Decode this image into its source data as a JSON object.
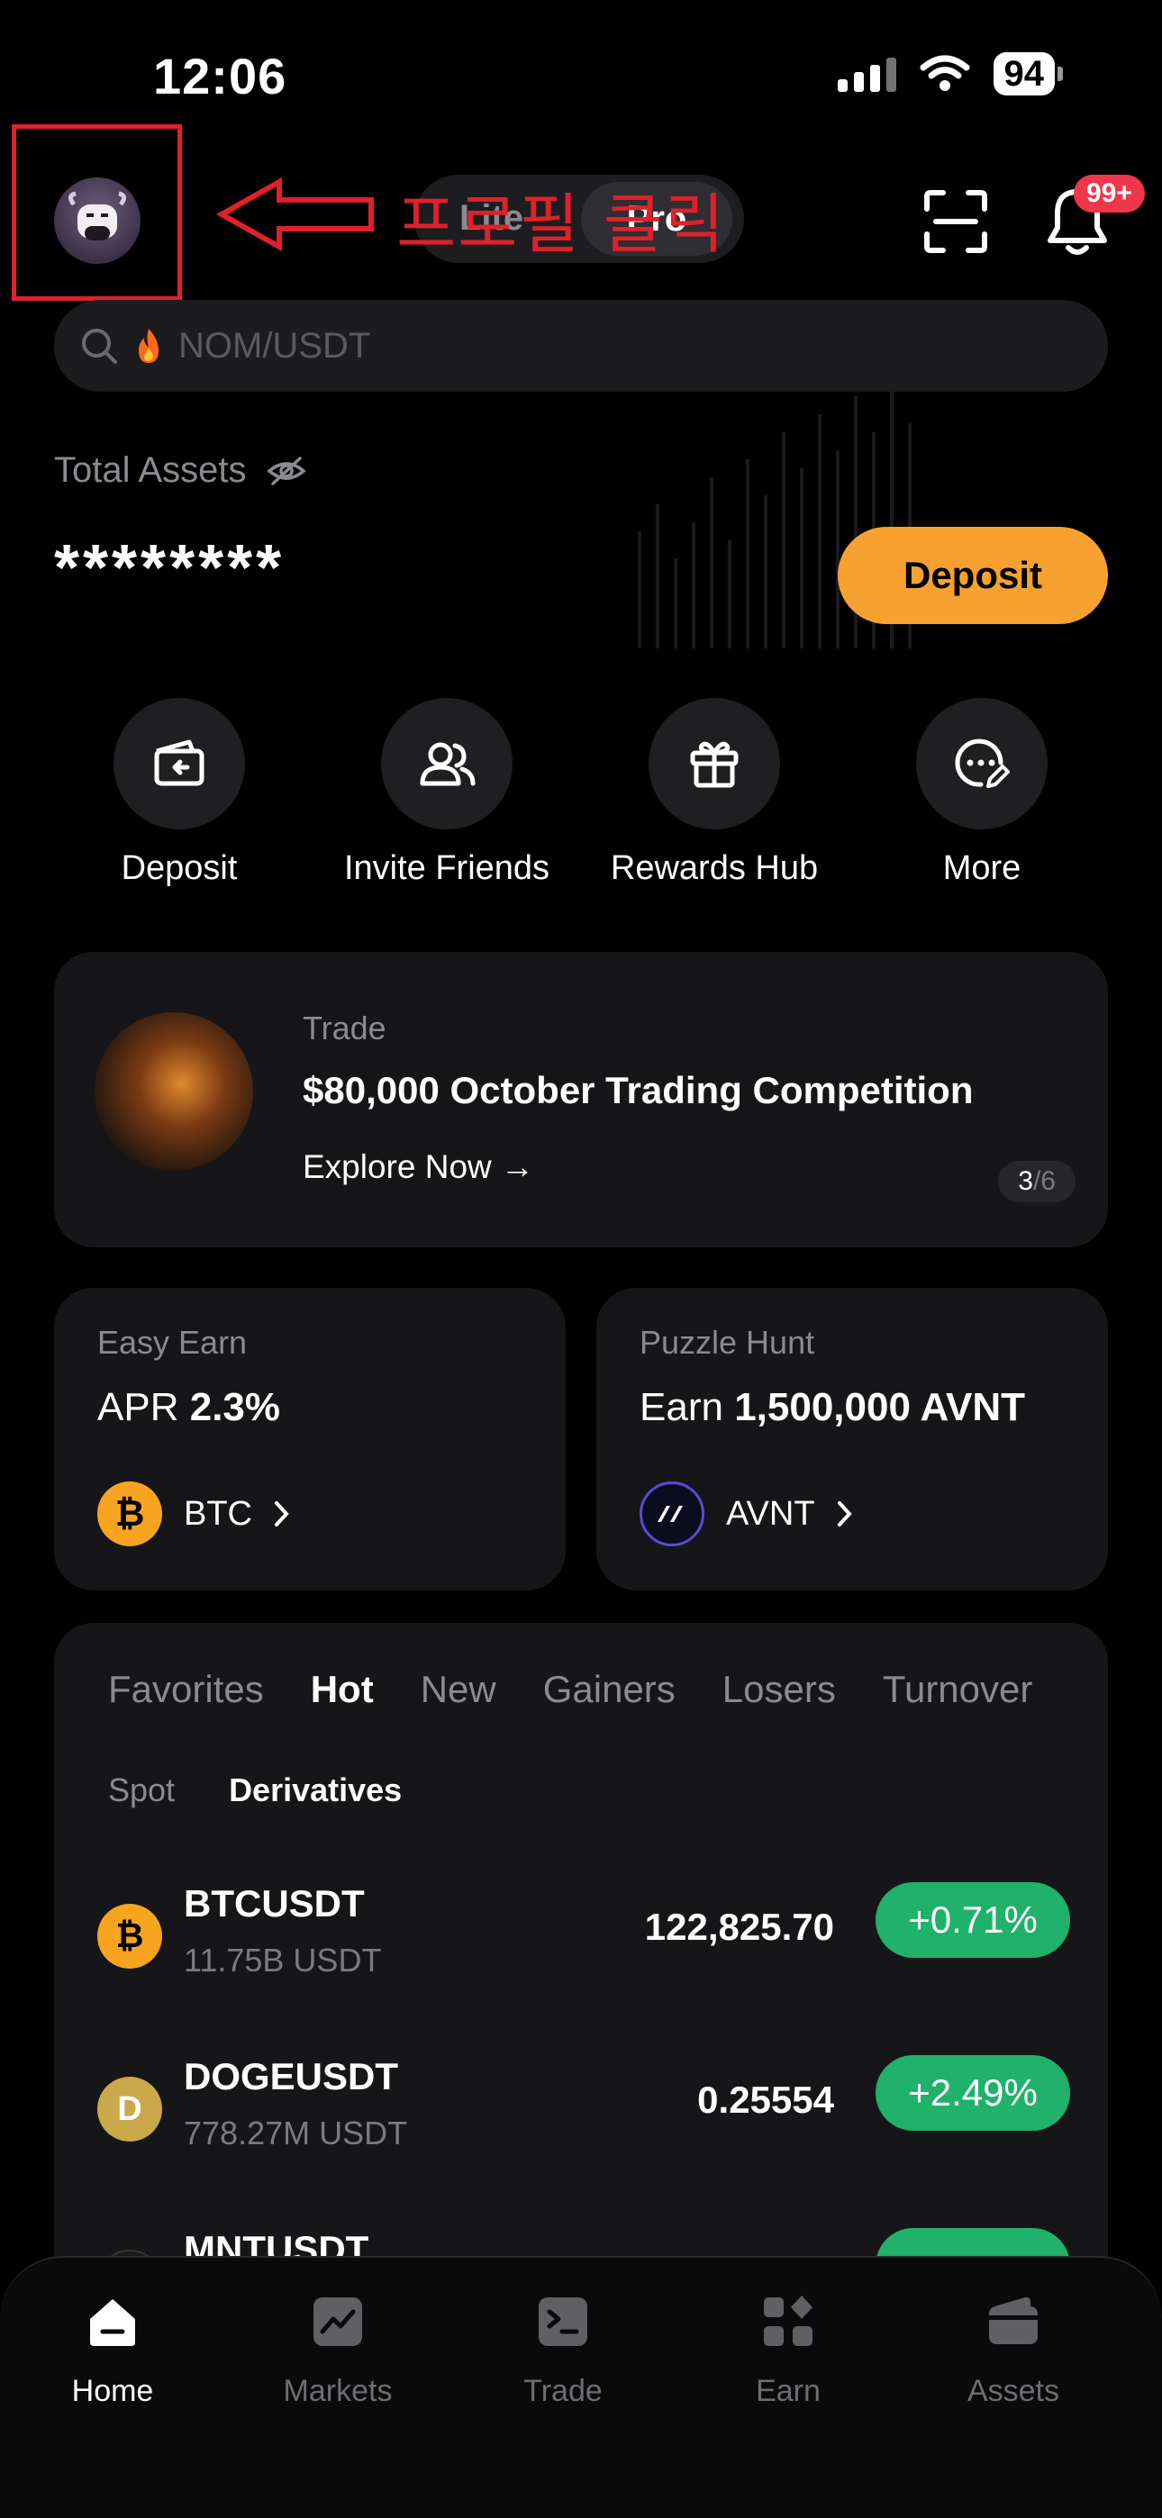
{
  "status_bar": {
    "time": "12:06",
    "battery": "94"
  },
  "header": {
    "mode_lite": "Lite",
    "mode_pro": "Pro",
    "annotation": "프로필 클릭",
    "notification_count": "99+"
  },
  "search": {
    "placeholder": "NOM/USDT"
  },
  "assets": {
    "label": "Total Assets",
    "value": "********",
    "deposit_button": "Deposit"
  },
  "quick_actions": [
    {
      "label": "Deposit",
      "icon": "wallet-icon"
    },
    {
      "label": "Invite Friends",
      "icon": "users-icon"
    },
    {
      "label": "Rewards Hub",
      "icon": "gift-icon"
    },
    {
      "label": "More",
      "icon": "more-icon"
    }
  ],
  "promo": {
    "category": "Trade",
    "title": "$80,000 October Trading Competition",
    "link": "Explore Now →",
    "page_current": "3",
    "page_total": "/6"
  },
  "earn_cards": [
    {
      "title": "Easy Earn",
      "prefix": "APR",
      "value": "2.3%",
      "coin": "BTC"
    },
    {
      "title": "Puzzle Hunt",
      "prefix": "Earn",
      "value": "1,500,000 AVNT",
      "coin": "AVNT"
    }
  ],
  "market": {
    "tabs": [
      "Favorites",
      "Hot",
      "New",
      "Gainers",
      "Losers",
      "Turnover"
    ],
    "active_tab": "Hot",
    "subtabs": [
      "Spot",
      "Derivatives"
    ],
    "active_subtab": "Derivatives",
    "rows": [
      {
        "symbol": "BTCUSDT",
        "volume": "11.75B USDT",
        "price": "122,825.70",
        "change": "+0.71%"
      },
      {
        "symbol": "DOGEUSDT",
        "volume": "778.27M USDT",
        "price": "0.25554",
        "change": "+2.49%"
      },
      {
        "symbol": "MNTUSDT",
        "volume": "",
        "price": "",
        "change": ""
      }
    ]
  },
  "bottom_nav": [
    {
      "label": "Home",
      "active": true
    },
    {
      "label": "Markets",
      "active": false
    },
    {
      "label": "Trade",
      "active": false
    },
    {
      "label": "Earn",
      "active": false
    },
    {
      "label": "Assets",
      "active": false
    }
  ],
  "colors": {
    "accent": "#f7a131",
    "positive": "#20b26a",
    "badge": "#f0364a",
    "annotation": "#e0202a"
  }
}
